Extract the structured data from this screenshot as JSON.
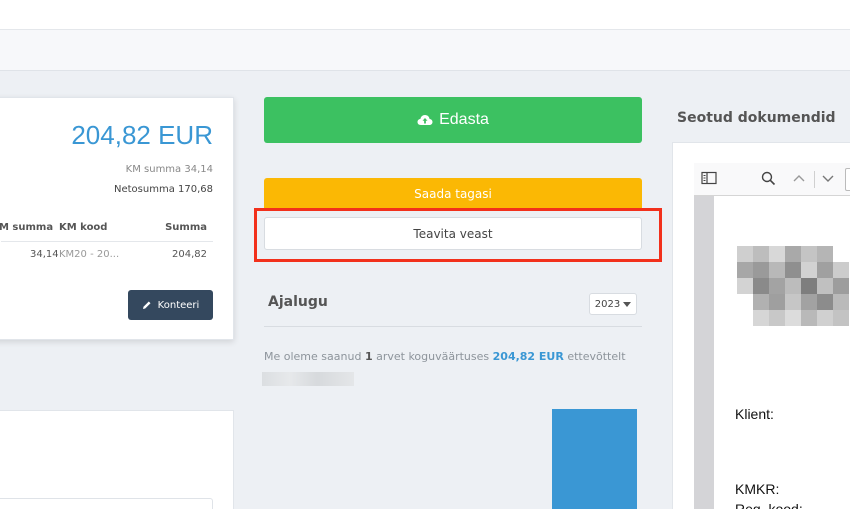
{
  "invoice": {
    "total": "204,82 EUR",
    "km_summa": "KM summa 34,14",
    "netosumma": "Netosumma 170,68",
    "columns": [
      "M summa",
      "KM kood",
      "Summa"
    ],
    "rows": [
      {
        "km_summa": "34,14",
        "km_kood": "KM20 - 20...",
        "summa": "204,82"
      }
    ],
    "konteeri_label": "Konteeri"
  },
  "actions": {
    "edasta_label": "Edasta",
    "saada_tagasi_label": "Saada tagasi",
    "teavita_veast_label": "Teavita veast"
  },
  "history": {
    "title": "Ajalugu",
    "year": "2023",
    "summary_prefix": "Me oleme saanud",
    "summary_count": "1",
    "summary_middle": "arvet koguväärtuses",
    "summary_amount": "204,82 EUR",
    "summary_suffix": "ettevõttelt",
    "bar_color": "#3a97d4"
  },
  "related_documents": {
    "title": "Seotud dokumendid",
    "viewer_icons": [
      "sidebar-toggle-icon",
      "search-icon",
      "chevron-up-icon",
      "chevron-down-icon"
    ],
    "doc_labels": [
      "Klient:",
      "KMKR:",
      "Reg. kood:"
    ]
  },
  "colors": {
    "accent_blue": "#3a97d4",
    "success_green": "#3cc161",
    "warning_yellow": "#fbb804",
    "dark_button": "#34485e",
    "highlight_red": "#f2301b"
  }
}
